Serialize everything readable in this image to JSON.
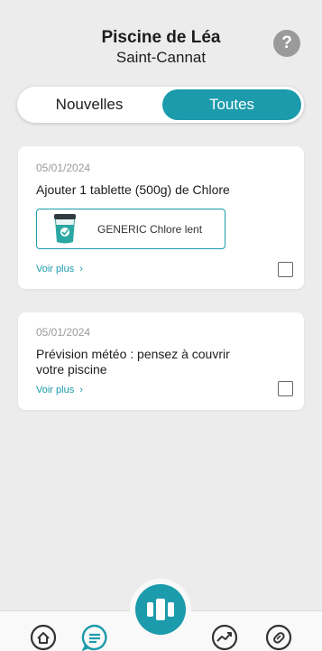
{
  "header": {
    "pool_name": "Piscine de Léa",
    "location": "Saint-Cannat",
    "help_label": "?"
  },
  "tabs": {
    "new_label": "Nouvelles",
    "all_label": "Toutes",
    "selected": "Toutes"
  },
  "notifications": [
    {
      "date": "05/01/2024",
      "title": "Ajouter 1 tablette (500g) de Chlore",
      "product": {
        "name": "GENERIC Chlore lent",
        "icon": "chlorine-bucket-icon"
      },
      "see_more": "Voir plus",
      "chevron": "›",
      "checked": false
    },
    {
      "date": "05/01/2024",
      "title": "Prévision météo : pensez à couvrir votre piscine",
      "see_more": "Voir plus",
      "chevron": "›",
      "checked": false
    }
  ],
  "nav": {
    "items": [
      "home-icon",
      "messages-icon",
      "pool-scan-icon",
      "stats-icon",
      "maintenance-icon"
    ],
    "active": "messages-icon"
  },
  "colors": {
    "accent": "#1b9bab",
    "background": "#ececec",
    "card": "#ffffff",
    "muted": "#9a9a9a"
  }
}
